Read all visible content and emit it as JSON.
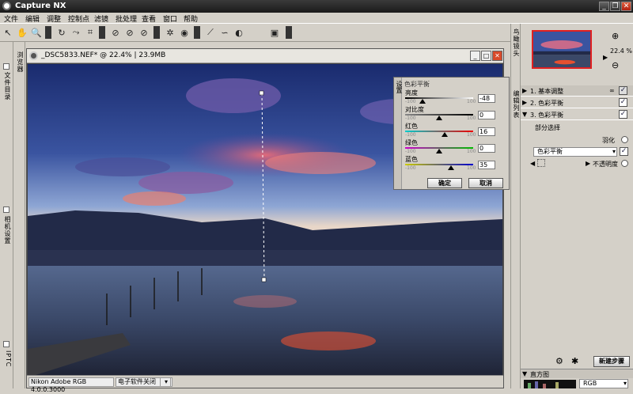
{
  "titlebar": {
    "title": "Capture NX"
  },
  "menu": [
    "文件",
    "编辑",
    "调整",
    "控制点",
    "滤镜",
    "批处理",
    "查看",
    "窗口",
    "帮助"
  ],
  "left_tabs": {
    "browser": "浏览器",
    "file_dir": "文件目录",
    "camera": "相机设置",
    "iptc": "IPTC"
  },
  "image_window": {
    "title": "_DSC5833.NEF* @ 22.4% | 23.9MB",
    "status_profile": "Nikon Adobe RGB 4.0.0.3000",
    "status_power": "电子软件关闭"
  },
  "dialog": {
    "side_label": "设置",
    "title": "色彩平衡",
    "min_tick": "-100",
    "max_tick": "100",
    "sliders": [
      {
        "label": "亮度",
        "value": "-48",
        "level": -48
      },
      {
        "label": "对比度",
        "value": "0",
        "level": 0
      },
      {
        "label": "红色",
        "value": "16",
        "level": 16
      },
      {
        "label": "绿色",
        "value": "0",
        "level": 0
      },
      {
        "label": "蓝色",
        "value": "35",
        "level": 35
      }
    ],
    "ok": "确定",
    "cancel": "取消"
  },
  "right_panel": {
    "birdseye_tab": "鸟瞰镜头",
    "edit_list_tab": "编辑列表",
    "zoom": "22.4 %",
    "steps": [
      {
        "label": "1. 基本调整",
        "checked": true
      },
      {
        "label": "2. 色彩平衡",
        "checked": true
      },
      {
        "label": "3. 色彩平衡",
        "checked": true
      }
    ],
    "partial_select": "部分选择",
    "feather": "羽化",
    "blend_mode": "色彩平衡",
    "opacity": "不透明度",
    "new_step": "新建步骤",
    "histogram": "直方图",
    "hist_channel": "RGB"
  },
  "colors": {
    "accent": "#e02020",
    "titlebar": "#1a1a1a"
  }
}
